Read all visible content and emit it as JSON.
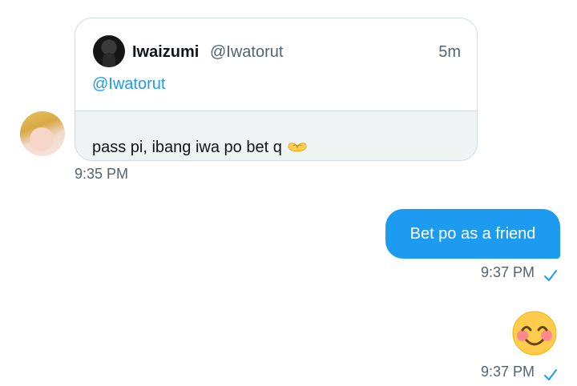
{
  "quoted_tweet": {
    "author_name": "Iwaizumi",
    "author_handle": "@Iwatorut",
    "time_ago": "5m",
    "mention": "@Iwatorut",
    "reply_text": "pass pi, ibang iwa po bet q",
    "reply_emoji_icon": "heart-hands-icon"
  },
  "messages": [
    {
      "side": "received",
      "time": "9:35 PM"
    },
    {
      "side": "sent",
      "text": "Bet po as a friend",
      "time": "9:37 PM",
      "status_icon": "check-icon"
    },
    {
      "side": "sent",
      "emoji_icon": "smiling-face-with-smiling-eyes-emoji",
      "time": "9:37 PM",
      "status_icon": "check-icon"
    }
  ],
  "colors": {
    "accent": "#1d9bf0",
    "muted": "#536471",
    "card_border": "#cfd9de",
    "card_footer_bg": "#eff3f4"
  }
}
